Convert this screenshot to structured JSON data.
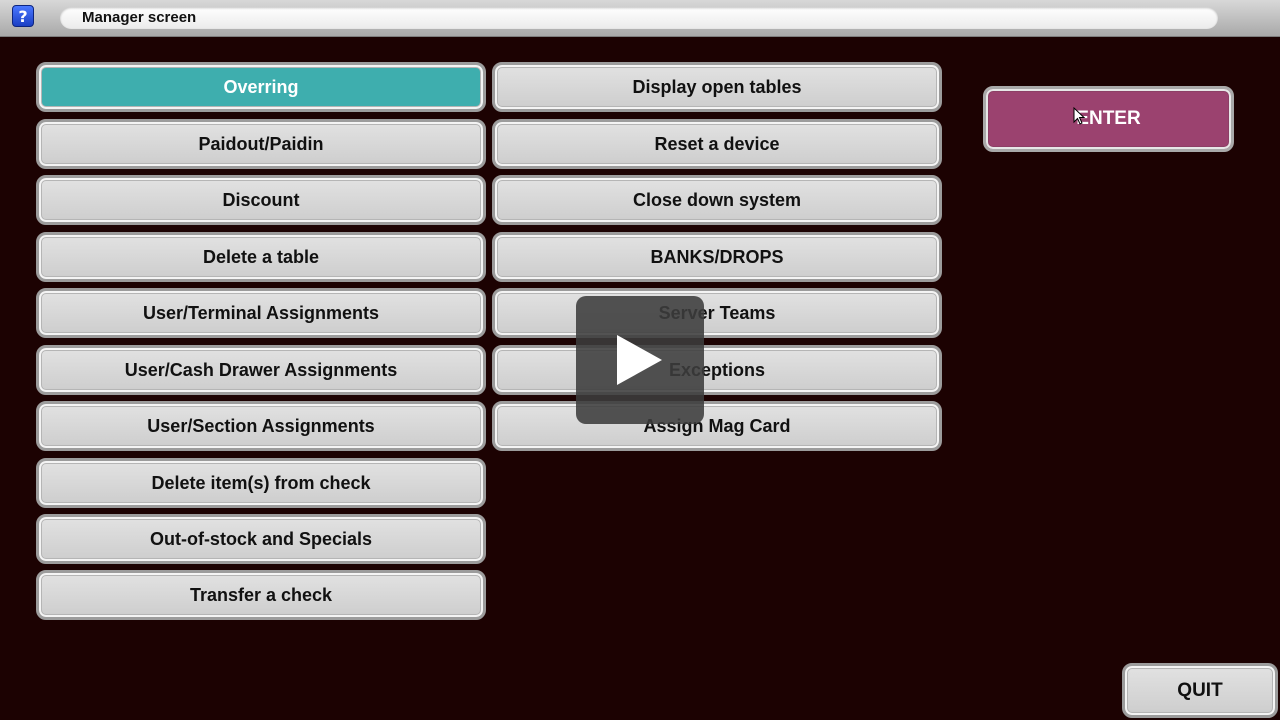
{
  "titlebar": {
    "help_icon": "help-icon",
    "title": "Manager screen"
  },
  "menu": {
    "left": [
      {
        "label": "Overring",
        "active": true
      },
      {
        "label": "Paidout/Paidin"
      },
      {
        "label": "Discount"
      },
      {
        "label": "Delete a table"
      },
      {
        "label": "User/Terminal Assignments"
      },
      {
        "label": "User/Cash Drawer Assignments"
      },
      {
        "label": "User/Section Assignments"
      },
      {
        "label": "Delete item(s) from check"
      },
      {
        "label": "Out-of-stock and Specials"
      },
      {
        "label": "Transfer a check"
      }
    ],
    "right": [
      {
        "label": "Display open tables"
      },
      {
        "label": "Reset a device"
      },
      {
        "label": "Close down system"
      },
      {
        "label": "BANKS/DROPS"
      },
      {
        "label": "Server Teams"
      },
      {
        "label": "Exceptions"
      },
      {
        "label": "Assign Mag Card"
      }
    ]
  },
  "actions": {
    "enter_label": "ENTER",
    "quit_label": "QUIT"
  },
  "colors": {
    "background": "#1c0202",
    "active_button": "#3eaeae",
    "enter_button": "#9b426f"
  },
  "overlay": {
    "icon": "play-icon"
  }
}
